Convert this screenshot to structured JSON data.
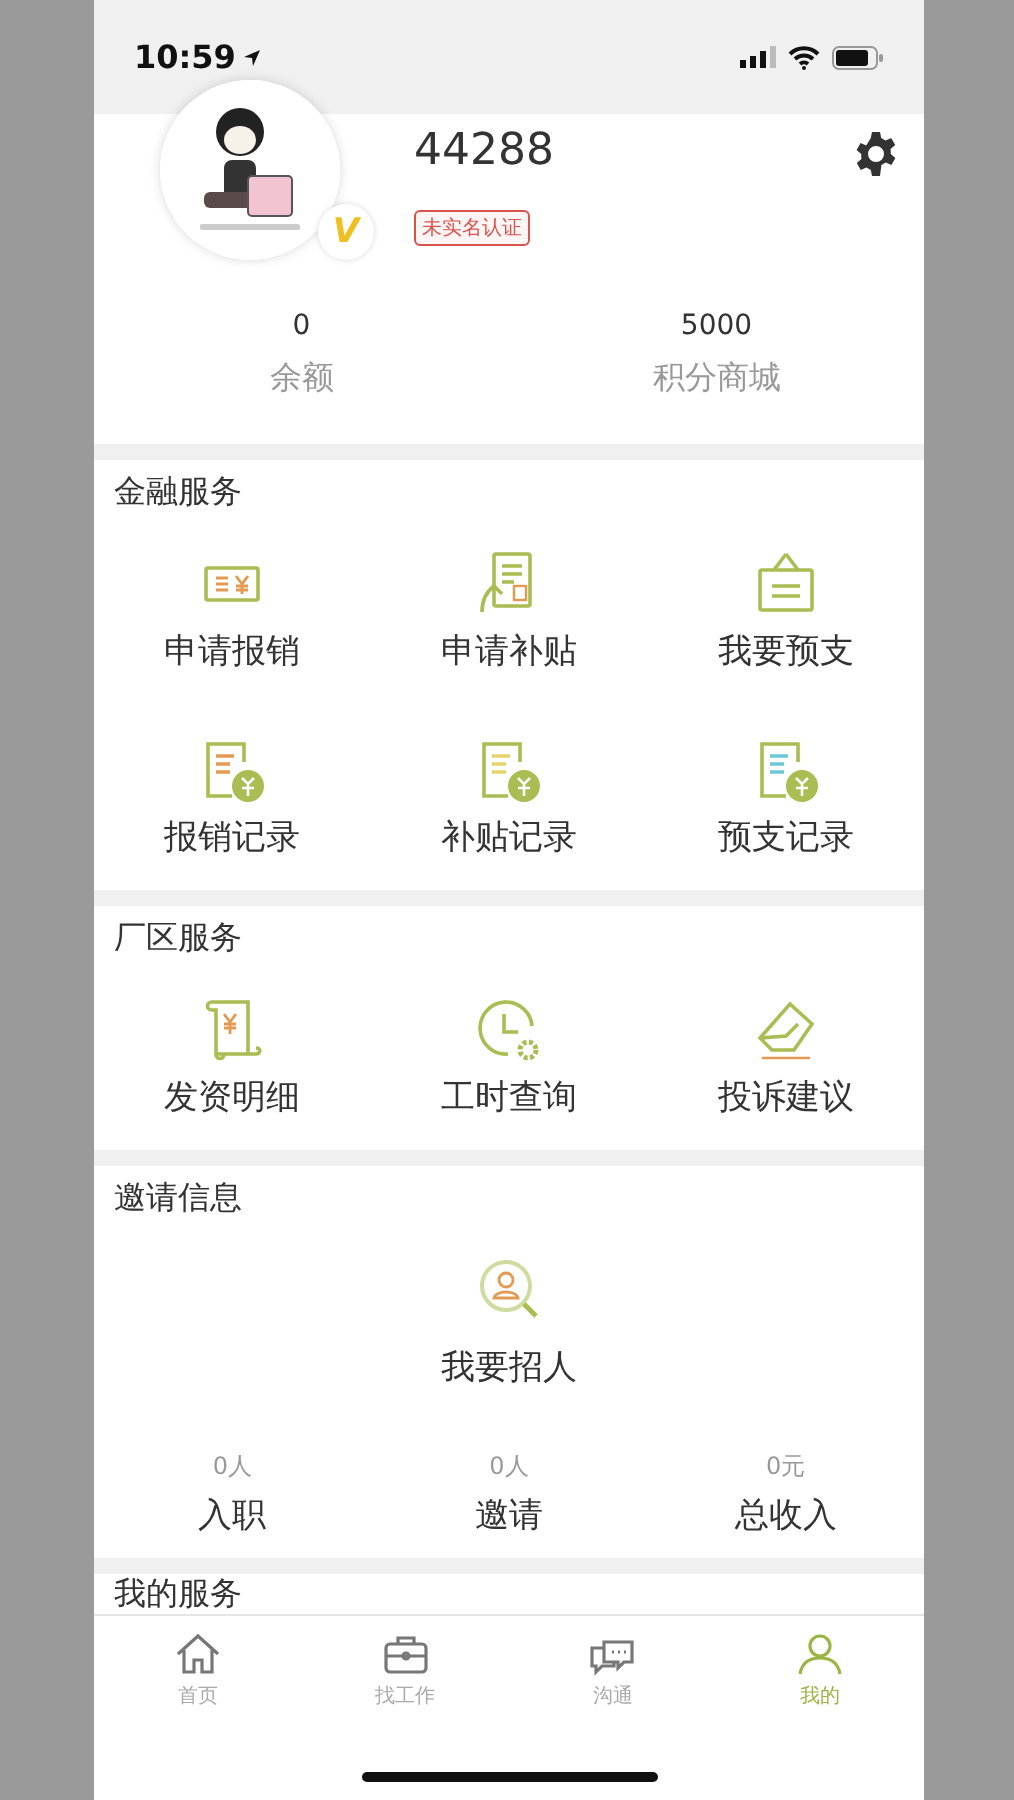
{
  "status_bar": {
    "time": "10:59"
  },
  "profile": {
    "name": "44288",
    "badge": "未实名认证",
    "vip_mark": "V"
  },
  "stats": [
    {
      "value": "0",
      "label": "余额"
    },
    {
      "value": "5000",
      "label": "积分商城"
    }
  ],
  "sections": [
    {
      "title": "金融服务",
      "items": [
        {
          "label": "申请报销"
        },
        {
          "label": "申请补贴"
        },
        {
          "label": "我要预支"
        },
        {
          "label": "报销记录"
        },
        {
          "label": "补贴记录"
        },
        {
          "label": "预支记录"
        }
      ]
    },
    {
      "title": "厂区服务",
      "items": [
        {
          "label": "发资明细"
        },
        {
          "label": "工时查询"
        },
        {
          "label": "投诉建议"
        }
      ]
    }
  ],
  "invite": {
    "title": "邀请信息",
    "action": "我要招人",
    "stats": [
      {
        "value": "0人",
        "label": "入职"
      },
      {
        "value": "0人",
        "label": "邀请"
      },
      {
        "value": "0元",
        "label": "总收入"
      }
    ]
  },
  "my_services": {
    "title": "我的服务"
  },
  "tabs": [
    {
      "label": "首页",
      "selected": false
    },
    {
      "label": "找工作",
      "selected": false
    },
    {
      "label": "沟通",
      "selected": false
    },
    {
      "label": "我的",
      "selected": true
    }
  ]
}
